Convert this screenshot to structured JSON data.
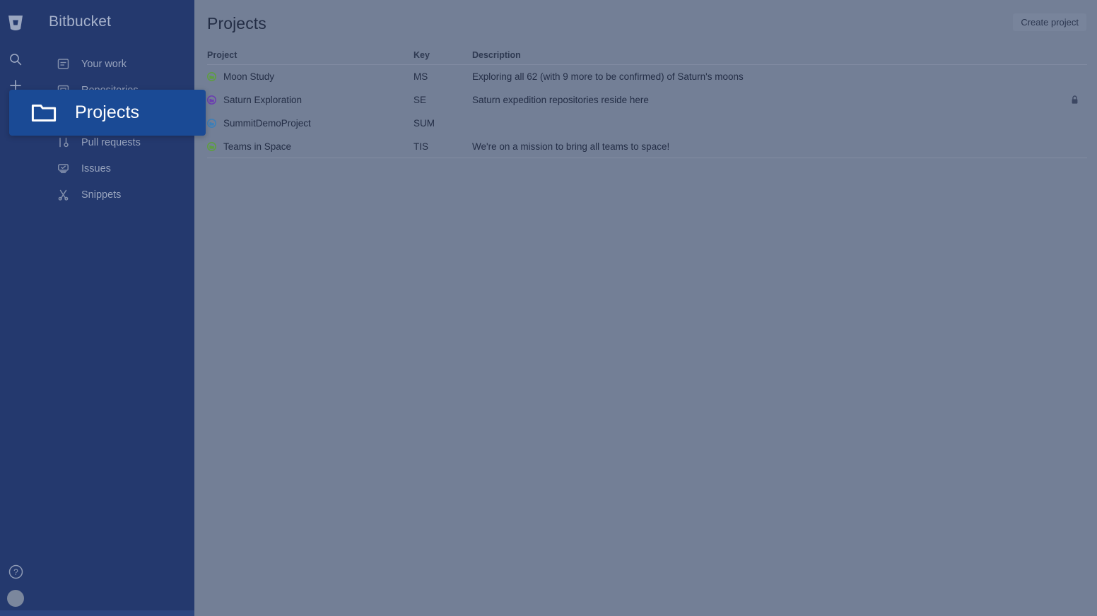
{
  "brand": {
    "name": "Bitbucket",
    "logo_icon": "bitbucket-logo-icon"
  },
  "rail": {
    "search_icon": "search-icon",
    "create_icon": "plus-icon",
    "help_icon": "help-circle-icon",
    "avatar_icon": "user-avatar"
  },
  "sidebar": {
    "items": [
      {
        "label": "Your work",
        "icon": "your-work-icon"
      },
      {
        "label": "Repositories",
        "icon": "repositories-icon"
      },
      {
        "label": "Projects",
        "icon": "projects-folder-icon"
      },
      {
        "label": "Pull requests",
        "icon": "pull-requests-icon"
      },
      {
        "label": "Issues",
        "icon": "issues-icon"
      },
      {
        "label": "Snippets",
        "icon": "snippets-scissors-icon"
      }
    ]
  },
  "tooltip": {
    "label": "Projects",
    "icon": "folder-icon",
    "background": "#1a4a95"
  },
  "main": {
    "page_title": "Projects",
    "create_button_label": "Create project",
    "columns": [
      "Project",
      "Key",
      "Description"
    ],
    "rows": [
      {
        "project": "Moon Study",
        "key": "MS",
        "description": "Exploring all 62 (with 9 more to be confirmed) of Saturn's moons",
        "avatar_color": "#5e9e41",
        "private": false
      },
      {
        "project": "Saturn Exploration",
        "key": "SE",
        "description": "Saturn expedition repositories reside here",
        "avatar_color": "#6b3fb0",
        "private": true,
        "lock_icon": "lock-icon"
      },
      {
        "project": "SummitDemoProject",
        "key": "SUM",
        "description": "",
        "avatar_color": "#3d7fb8",
        "private": false
      },
      {
        "project": "Teams in Space",
        "key": "TIS",
        "description": "We're on a mission to bring all teams to space!",
        "avatar_color": "#5e9e41",
        "private": false
      }
    ]
  },
  "colors": {
    "sidebar": "#24396e",
    "content_overlay": "#737f96",
    "accent": "#1a4a95"
  }
}
